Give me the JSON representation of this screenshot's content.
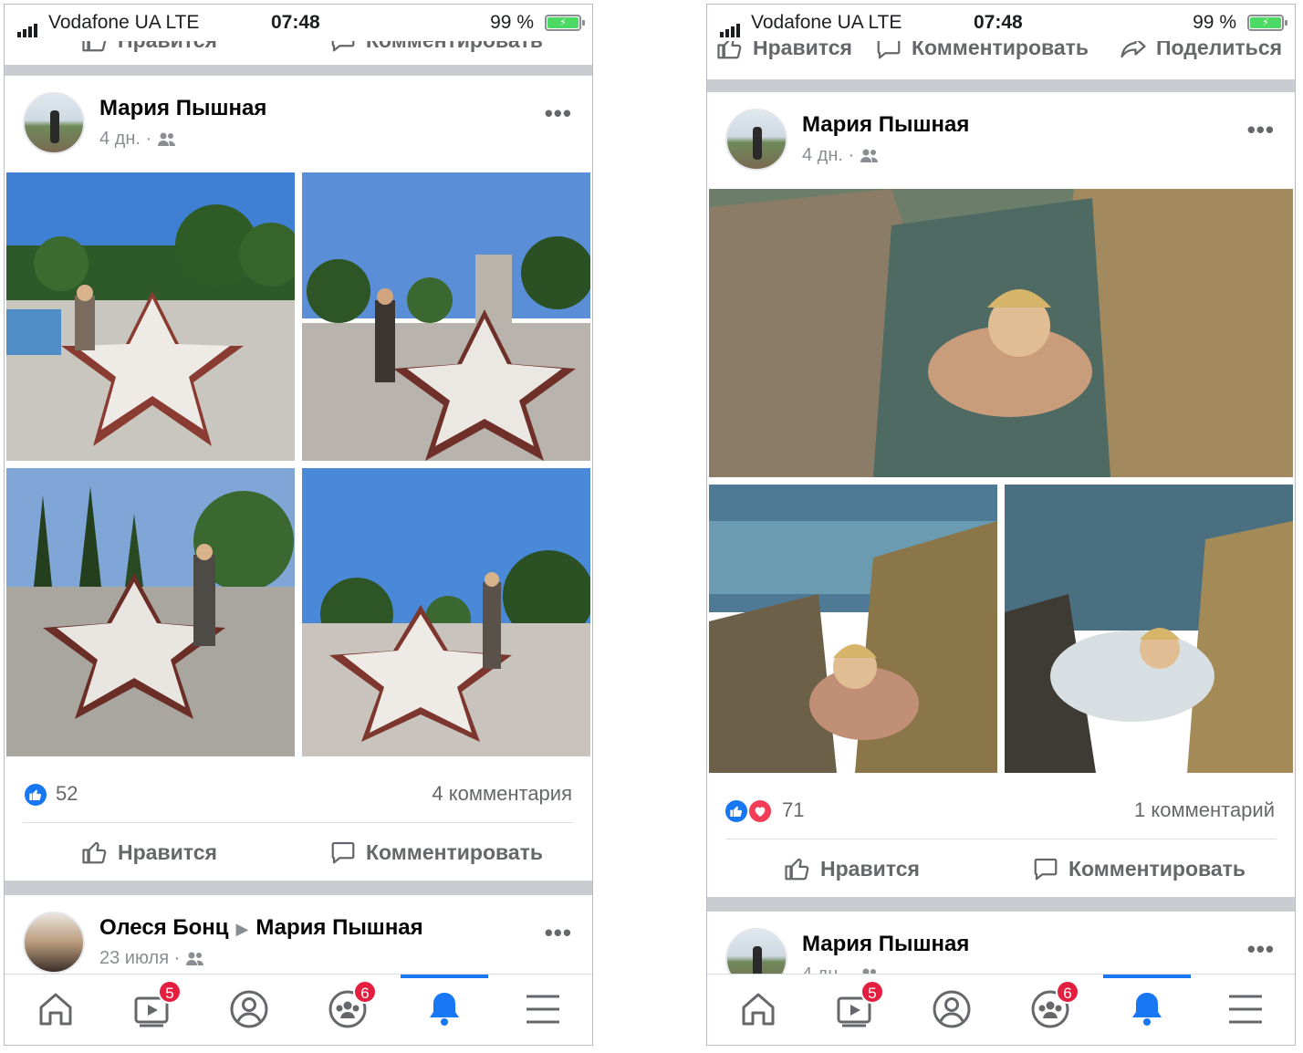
{
  "status_bar": {
    "carrier": "Vodafone UA  LTE",
    "time": "07:48",
    "battery": "99 %"
  },
  "actions": {
    "like": "Нравится",
    "comment": "Комментировать",
    "share": "Поделиться"
  },
  "left_screen": {
    "post": {
      "author": "Мария Пышная",
      "time": "4 дн. ·",
      "more": "•••",
      "likes": "52",
      "comments": "4 комментария"
    },
    "next_post": {
      "author": "Олеся Бонц",
      "target": "Мария Пышная",
      "time": "23 июля ·",
      "more": "•••"
    }
  },
  "right_screen": {
    "post": {
      "author": "Мария Пышная",
      "time": "4 дн. ·",
      "more": "•••",
      "likes": "71",
      "comments": "1 комментарий"
    },
    "next_post": {
      "author": "Мария Пышная",
      "time": "4 дн. ·",
      "more": "•••"
    }
  },
  "tab_bar": {
    "video_badge": "5",
    "groups_badge": "6",
    "active_tab": "notifications",
    "accent_color": "#1877f2",
    "badge_color": "#e41e3f"
  }
}
